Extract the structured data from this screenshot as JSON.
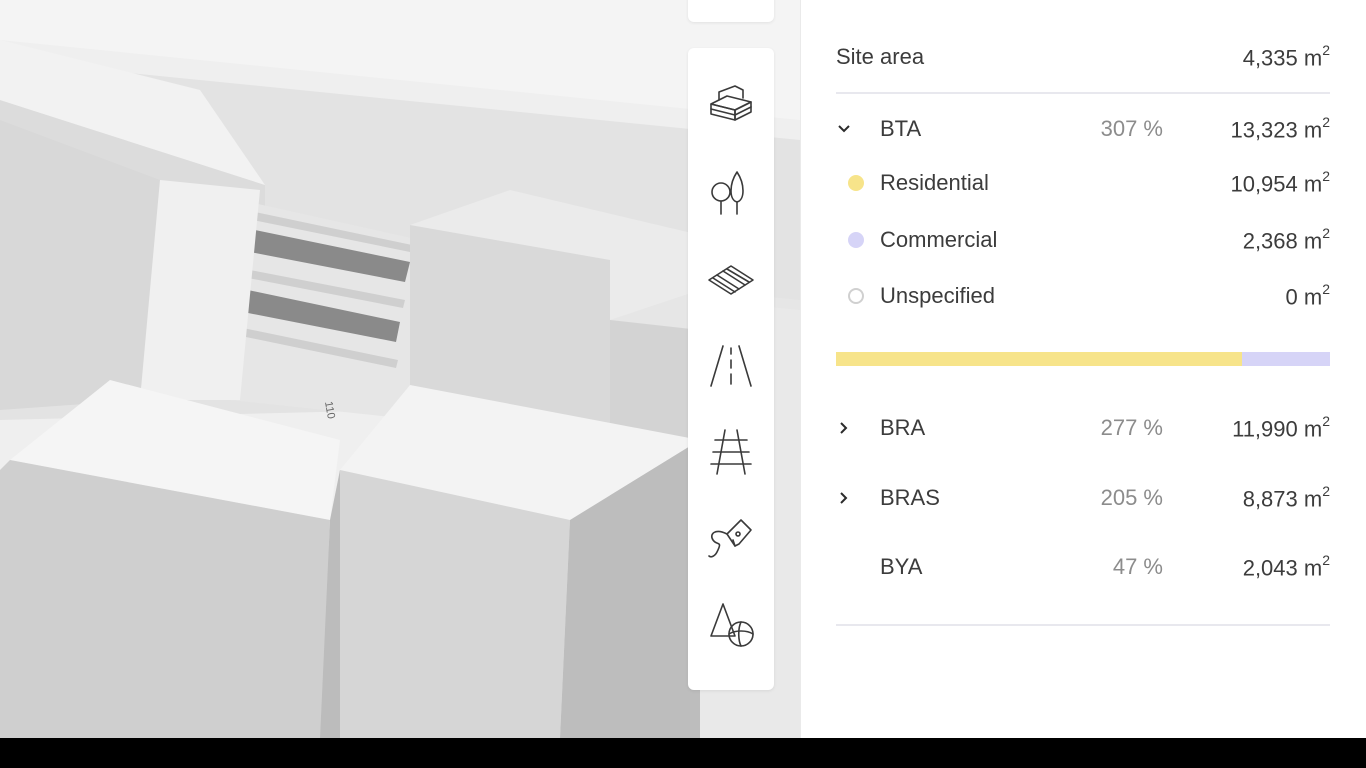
{
  "panel": {
    "site_area": {
      "label": "Site area",
      "value": "4,335 m",
      "unit_sup": "2"
    },
    "bta": {
      "label": "BTA",
      "percent": "307 %",
      "value": "13,323 m",
      "unit_sup": "2",
      "expanded": true,
      "breakdown": [
        {
          "label": "Residential",
          "value": "10,954 m",
          "unit_sup": "2",
          "color": "#f7e48a"
        },
        {
          "label": "Commercial",
          "value": "2,368 m",
          "unit_sup": "2",
          "color": "#d6d4f7"
        },
        {
          "label": "Unspecified",
          "value": "0 m",
          "unit_sup": "2",
          "color": "#ffffff"
        }
      ],
      "bar_fractions": {
        "residential": 0.822,
        "commercial": 0.178
      }
    },
    "bra": {
      "label": "BRA",
      "percent": "277 %",
      "value": "11,990 m",
      "unit_sup": "2"
    },
    "bras": {
      "label": "BRAS",
      "percent": "205 %",
      "value": "8,873 m",
      "unit_sup": "2"
    },
    "bya": {
      "label": "BYA",
      "percent": "47 %",
      "value": "2,043 m",
      "unit_sup": "2"
    }
  },
  "toolbar": {
    "tools": [
      "building-icon",
      "tree-icon",
      "area-hatch-icon",
      "road-icon",
      "railway-icon",
      "pen-draw-icon",
      "shapes-icon"
    ]
  },
  "viewport": {
    "road_marker": "110"
  },
  "colors": {
    "residential": "#f7e48a",
    "commercial": "#d6d4f7",
    "text": "#3c3c3c",
    "muted": "#8c8c8c"
  }
}
